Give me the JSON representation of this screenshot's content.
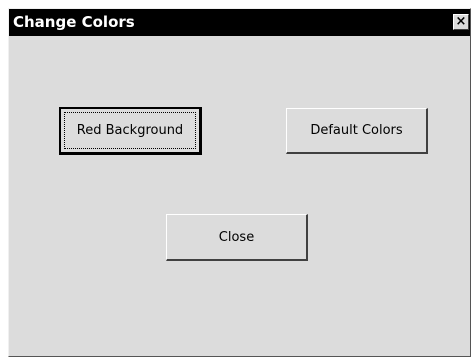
{
  "window": {
    "title": "Change Colors",
    "close_glyph": "×"
  },
  "buttons": {
    "red_background": "Red Background",
    "default_colors": "Default Colors",
    "close": "Close"
  },
  "colors": {
    "dialog_bg": "#dcdcdc",
    "titlebar_bg": "#000000",
    "title_text": "#ffffff"
  }
}
